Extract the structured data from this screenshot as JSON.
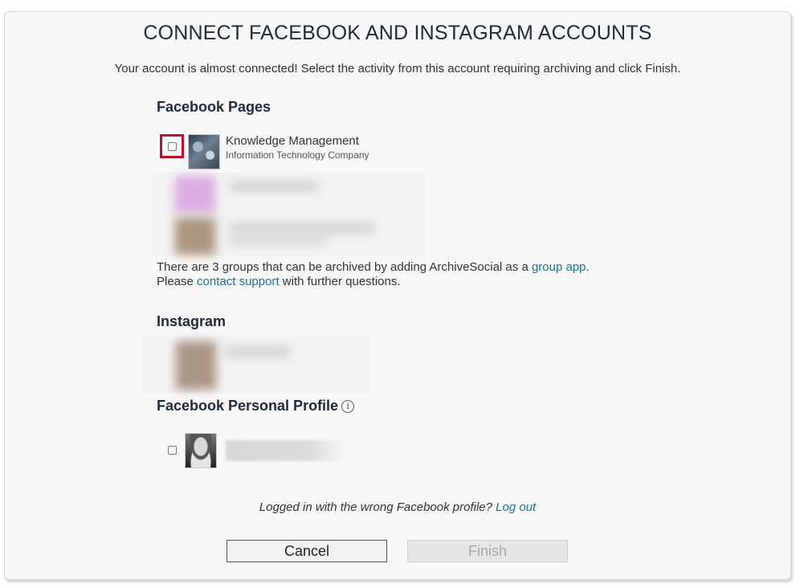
{
  "dialog": {
    "title": "CONNECT FACEBOOK AND INSTAGRAM ACCOUNTS",
    "subtitle": "Your account is almost connected! Select the activity from this account requiring archiving and click Finish."
  },
  "facebook_pages": {
    "heading": "Facebook Pages",
    "items": [
      {
        "name": "Knowledge Management",
        "category": "Information Technology Company",
        "checked": false
      }
    ],
    "groups_note": {
      "prefix": "There are 3 groups that can be archived by adding ArchiveSocial as a ",
      "group_app_link": "group app",
      "suffix": ".",
      "line2_prefix": "Please ",
      "contact_link": "contact support",
      "line2_suffix": " with further questions."
    }
  },
  "instagram": {
    "heading": "Instagram"
  },
  "personal_profile": {
    "heading": "Facebook Personal Profile",
    "info_icon": "info-circle-icon",
    "checked": false
  },
  "footer": {
    "wrong_profile_text": "Logged in with the wrong Facebook profile? ",
    "logout_link": "Log out",
    "cancel_label": "Cancel",
    "finish_label": "Finish"
  },
  "colors": {
    "link": "#1f6fa4",
    "highlight": "#b5152b",
    "heading": "#1f2a3a"
  }
}
